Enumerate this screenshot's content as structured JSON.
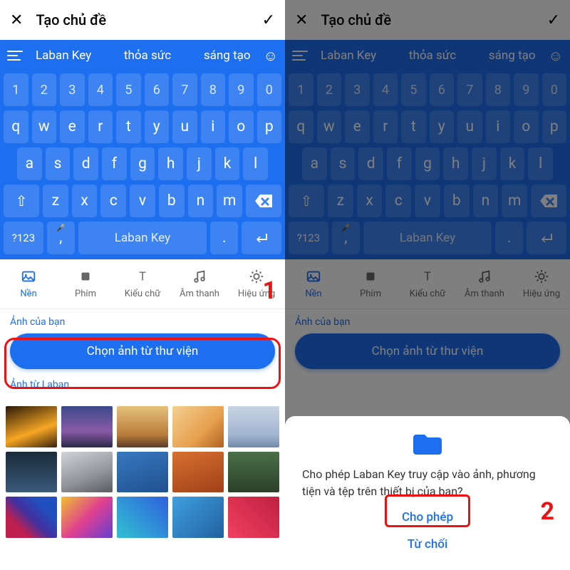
{
  "header": {
    "close": "✕",
    "title": "Tạo chủ đề",
    "confirm": "✓"
  },
  "keyboard": {
    "suggest": [
      "Laban Key",
      "thỏa sức",
      "sáng tạo"
    ],
    "rows": {
      "num": [
        "1",
        "2",
        "3",
        "4",
        "5",
        "6",
        "7",
        "8",
        "9",
        "0"
      ],
      "r1": [
        "q",
        "w",
        "e",
        "r",
        "t",
        "y",
        "u",
        "i",
        "o",
        "p"
      ],
      "r2": [
        "a",
        "s",
        "d",
        "f",
        "g",
        "h",
        "j",
        "k",
        "l"
      ],
      "r3": [
        "z",
        "x",
        "c",
        "v",
        "b",
        "n",
        "m"
      ]
    },
    "shift": "⇧",
    "fn": "?123",
    "comma": ",",
    "space": "Laban Key",
    "dot": "."
  },
  "tabs": [
    {
      "label": "Nền",
      "active": true
    },
    {
      "label": "Phím",
      "active": false
    },
    {
      "label": "Kiểu chữ",
      "active": false
    },
    {
      "label": "Âm thanh",
      "active": false
    },
    {
      "label": "Hiệu ứng",
      "active": false
    }
  ],
  "sections": {
    "your_photos": "Ảnh của bạn",
    "pick_button": "Chọn ảnh từ thư viện",
    "from_laban": "Ảnh từ Laban"
  },
  "dialog": {
    "message": "Cho phép Laban Key truy cập vào ảnh, phương tiện và tệp trên thiết bị của bạn?",
    "allow": "Cho phép",
    "deny": "Từ chối"
  },
  "steps": {
    "one": "1",
    "two": "2"
  },
  "thumbs": [
    "linear-gradient(160deg,#2a1a08,#f6a623 60%,#3a2410)",
    "linear-gradient(180deg,#3a4a8a,#8a5aa8 60%,#2a2a4a)",
    "linear-gradient(180deg,#e6c27a,#b87a3a 70%,#5a3a2a)",
    "linear-gradient(135deg,#f2d090,#e8a050 60%,#b06020)",
    "linear-gradient(180deg,#c8d4e4,#a0b4d0 70%,#7088a8)",
    "linear-gradient(180deg,#1a2a3a,#3a5a7a)",
    "linear-gradient(160deg,#d0d4d8,#909498 60%,#585c60)",
    "linear-gradient(160deg,#3878c0,#205090)",
    "linear-gradient(160deg,#d87030,#a04018)",
    "linear-gradient(180deg,#4a7048,#2a4028)",
    "linear-gradient(45deg,#c02050 25%,#4030a0 50%,#2050c0 75%)",
    "linear-gradient(135deg,#f0c030,#e04090 50%,#6040d0)",
    "linear-gradient(45deg,#30c0d0,#3060e0)",
    "linear-gradient(135deg,#40a0e0,#2060a0)",
    "linear-gradient(45deg,#f04060,#c02040)"
  ]
}
